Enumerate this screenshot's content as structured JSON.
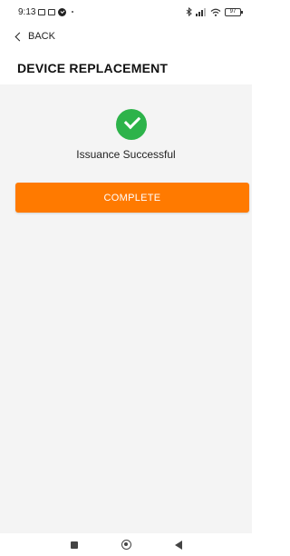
{
  "status_bar": {
    "time": "9:13",
    "battery": "97"
  },
  "nav": {
    "back_label": "BACK"
  },
  "page": {
    "title": "DEVICE REPLACEMENT"
  },
  "result": {
    "message": "Issuance Successful",
    "icon": "check-circle-icon",
    "icon_color": "#2db34a"
  },
  "actions": {
    "complete_label": "COMPLETE",
    "complete_color": "#ff7a00"
  }
}
